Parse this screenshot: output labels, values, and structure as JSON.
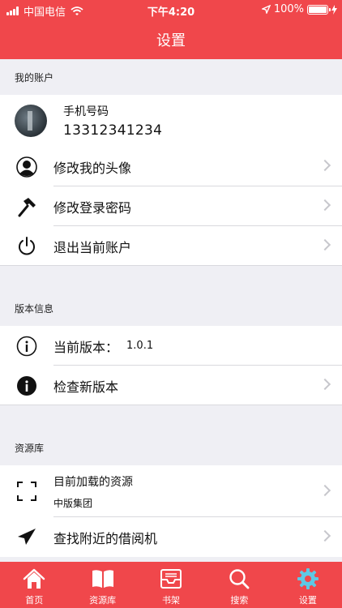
{
  "status_bar": {
    "carrier": "中国电信",
    "time": "下午4:20",
    "battery": "100%"
  },
  "header": {
    "title": "设置"
  },
  "sections": {
    "account": {
      "label": "我的账户",
      "phone_label": "手机号码",
      "phone_value": "13312341234",
      "items": [
        {
          "label": "修改我的头像",
          "icon": "user-circle-icon"
        },
        {
          "label": "修改登录密码",
          "icon": "hammer-icon"
        },
        {
          "label": "退出当前账户",
          "icon": "power-icon"
        }
      ]
    },
    "version": {
      "label": "版本信息",
      "current_label": "当前版本：",
      "current_value": "1.0.1",
      "check_label": "检查新版本"
    },
    "library": {
      "label": "资源库",
      "loaded_title": "目前加载的资源",
      "loaded_value": "中版集团",
      "nearby_label": "查找附近的借阅机"
    }
  },
  "tabbar": {
    "items": [
      {
        "label": "首页",
        "icon": "home-icon"
      },
      {
        "label": "资源库",
        "icon": "book-icon"
      },
      {
        "label": "书架",
        "icon": "inbox-icon"
      },
      {
        "label": "搜索",
        "icon": "search-icon"
      },
      {
        "label": "设置",
        "icon": "gear-icon",
        "active": true
      }
    ],
    "active_color": "#5ec8e4"
  },
  "colors": {
    "brand": "#f0474b",
    "background": "#efeff4"
  }
}
